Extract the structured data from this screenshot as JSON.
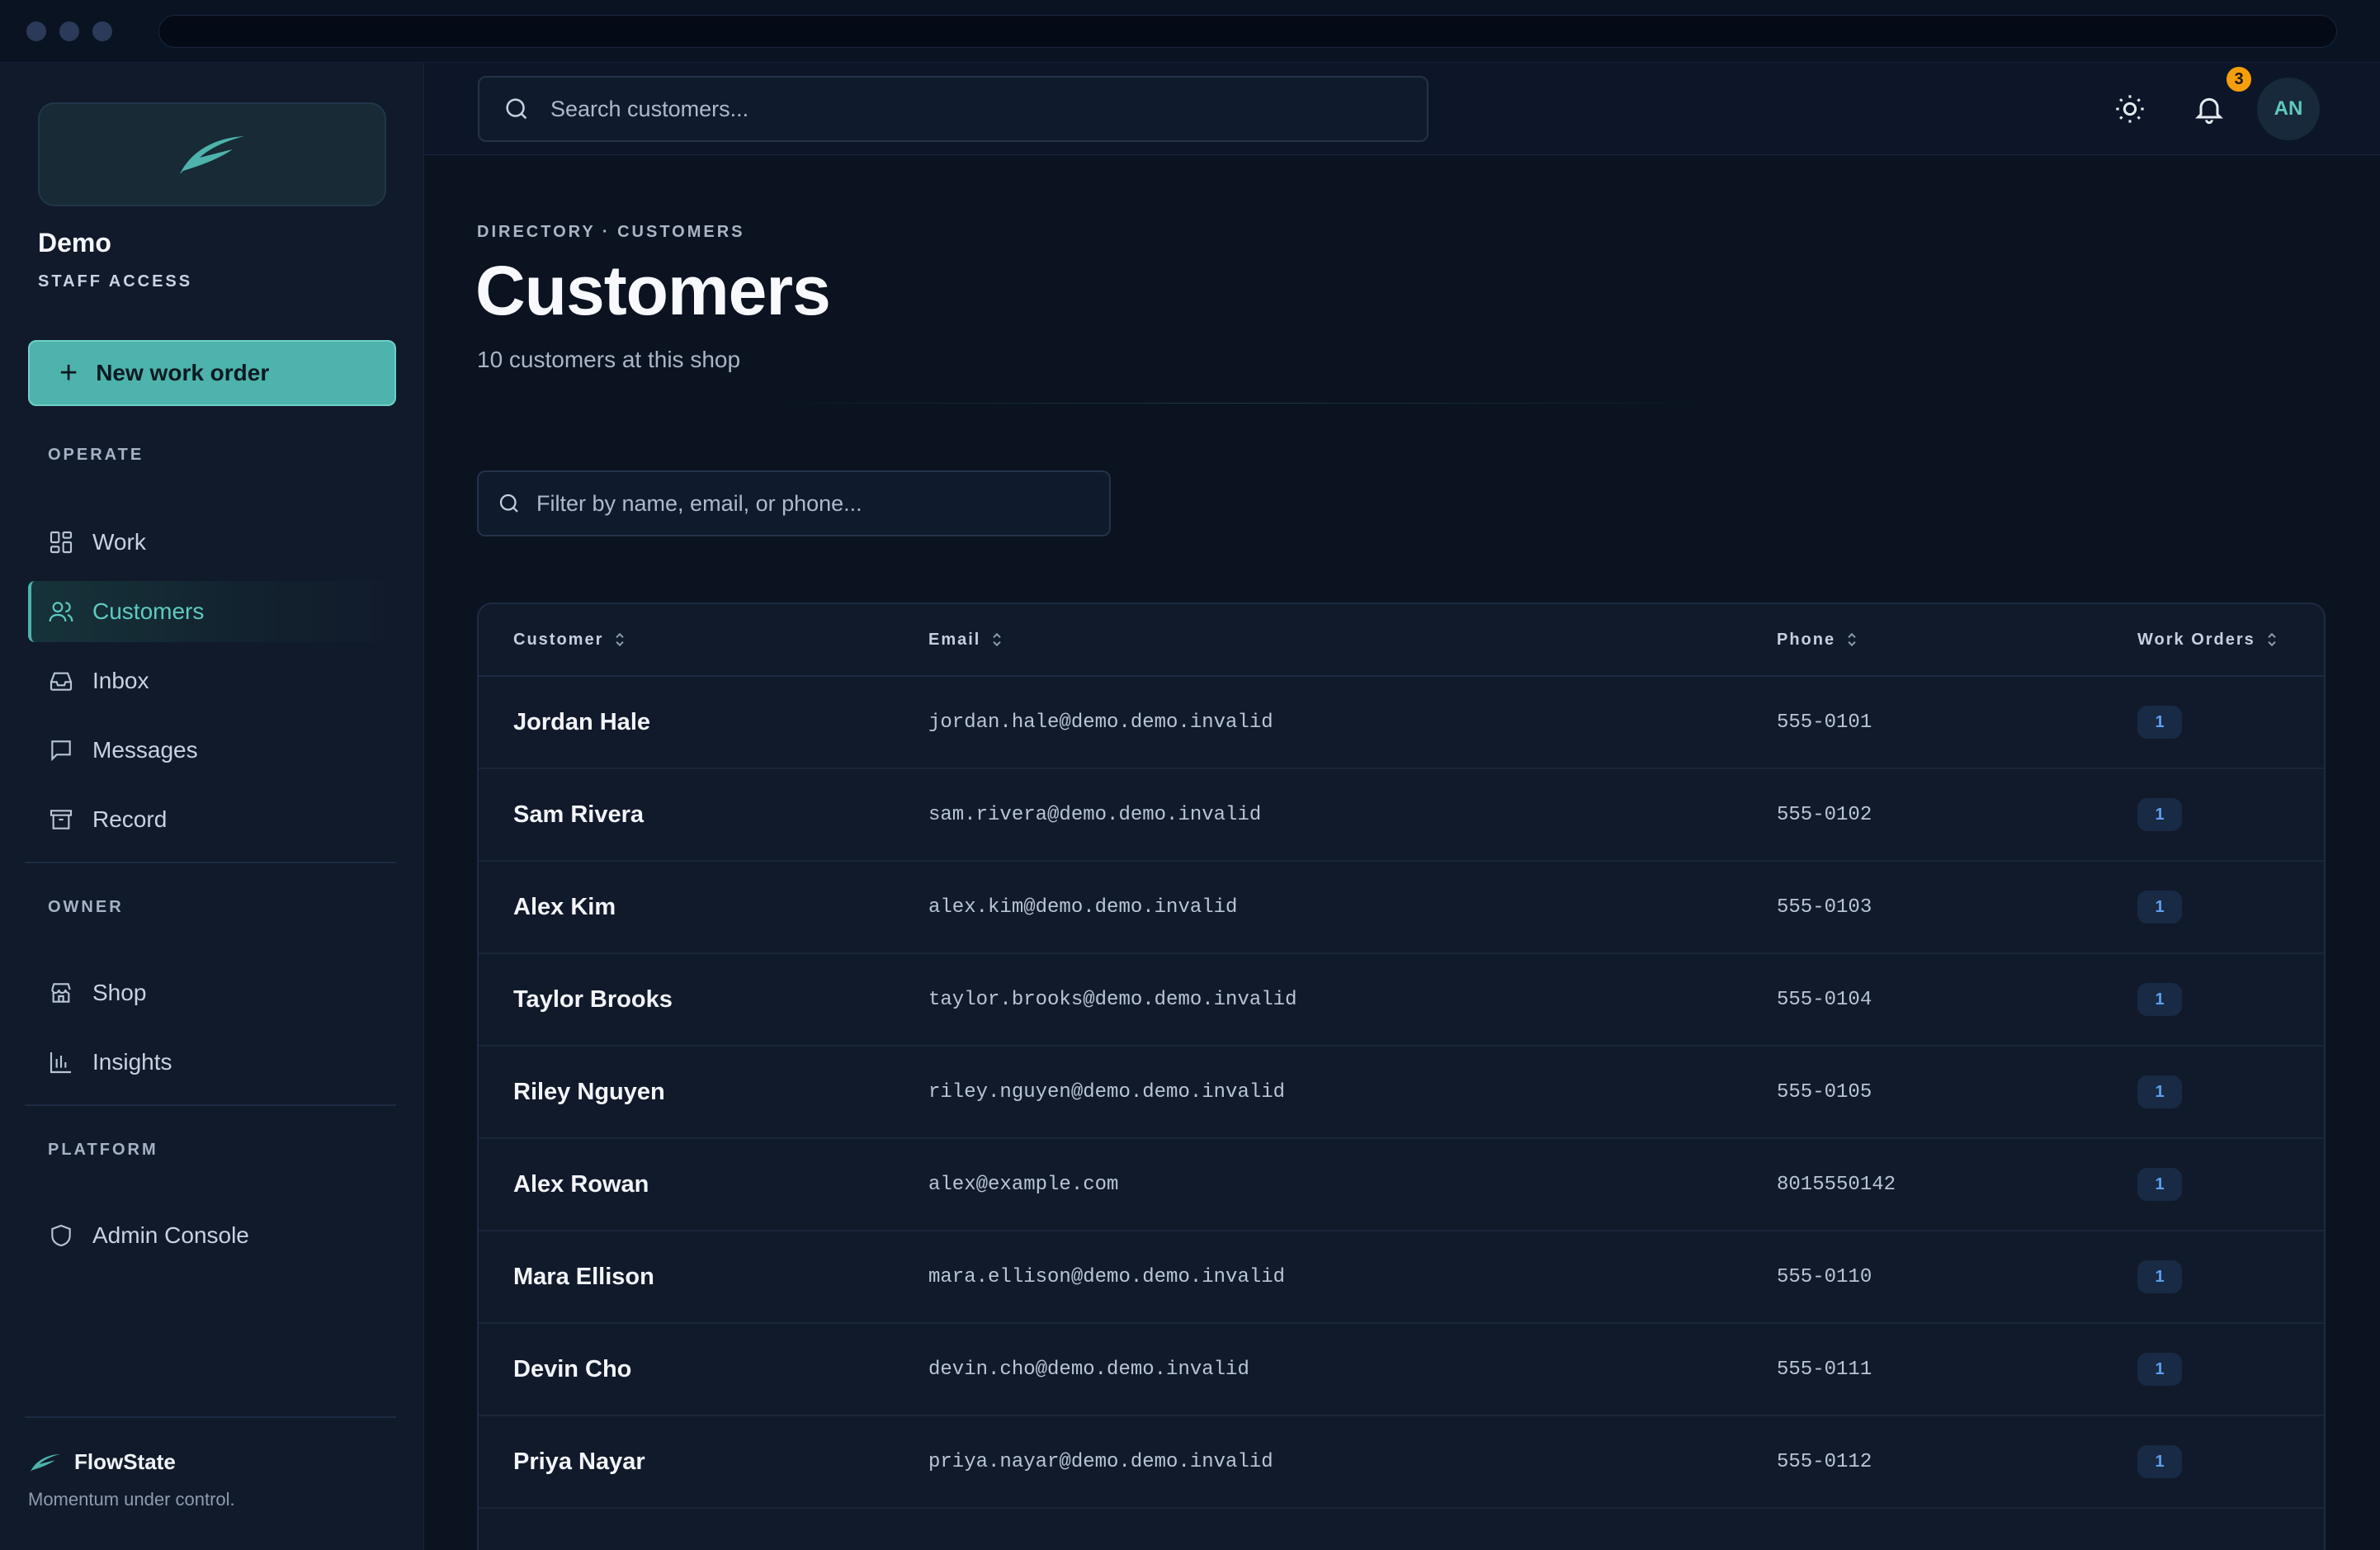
{
  "shop": {
    "name": "Demo",
    "role": "STAFF ACCESS"
  },
  "sidebar": {
    "new_work_order": "New work order",
    "sections": {
      "operate": "OPERATE",
      "owner": "OWNER",
      "platform": "PLATFORM"
    },
    "items": [
      {
        "label": "Work",
        "icon": "grid-icon"
      },
      {
        "label": "Customers",
        "icon": "users-icon",
        "active": true
      },
      {
        "label": "Inbox",
        "icon": "inbox-icon"
      },
      {
        "label": "Messages",
        "icon": "message-icon"
      },
      {
        "label": "Record",
        "icon": "archive-icon"
      },
      {
        "label": "Shop",
        "icon": "store-icon"
      },
      {
        "label": "Insights",
        "icon": "bar-chart-icon"
      },
      {
        "label": "Admin Console",
        "icon": "shield-icon"
      }
    ],
    "brand": {
      "name": "FlowState",
      "tagline": "Momentum under control."
    }
  },
  "topbar": {
    "search_placeholder": "Search customers...",
    "notification_count": "3",
    "avatar_initials": "AN"
  },
  "page": {
    "breadcrumb": "DIRECTORY · CUSTOMERS",
    "title": "Customers",
    "subtitle": "10 customers at this shop",
    "filter_placeholder": "Filter by name, email, or phone..."
  },
  "table": {
    "columns": [
      "Customer",
      "Email",
      "Phone",
      "Work Orders"
    ],
    "rows": [
      {
        "name": "Jordan Hale",
        "email": "jordan.hale@demo.demo.invalid",
        "phone": "555-0101",
        "orders": "1"
      },
      {
        "name": "Sam Rivera",
        "email": "sam.rivera@demo.demo.invalid",
        "phone": "555-0102",
        "orders": "1"
      },
      {
        "name": "Alex Kim",
        "email": "alex.kim@demo.demo.invalid",
        "phone": "555-0103",
        "orders": "1"
      },
      {
        "name": "Taylor Brooks",
        "email": "taylor.brooks@demo.demo.invalid",
        "phone": "555-0104",
        "orders": "1"
      },
      {
        "name": "Riley Nguyen",
        "email": "riley.nguyen@demo.demo.invalid",
        "phone": "555-0105",
        "orders": "1"
      },
      {
        "name": "Alex Rowan",
        "email": "alex@example.com",
        "phone": "8015550142",
        "orders": "1"
      },
      {
        "name": "Mara Ellison",
        "email": "mara.ellison@demo.demo.invalid",
        "phone": "555-0110",
        "orders": "1"
      },
      {
        "name": "Devin Cho",
        "email": "devin.cho@demo.demo.invalid",
        "phone": "555-0111",
        "orders": "1"
      },
      {
        "name": "Priya Nayar",
        "email": "priya.nayar@demo.demo.invalid",
        "phone": "555-0112",
        "orders": "1"
      }
    ]
  },
  "colors": {
    "accent": "#4db3ac",
    "background": "#0b1220",
    "sidebar": "#111a2b",
    "badge": "#f59e0b",
    "orders_pill_text": "#5e9eef"
  }
}
